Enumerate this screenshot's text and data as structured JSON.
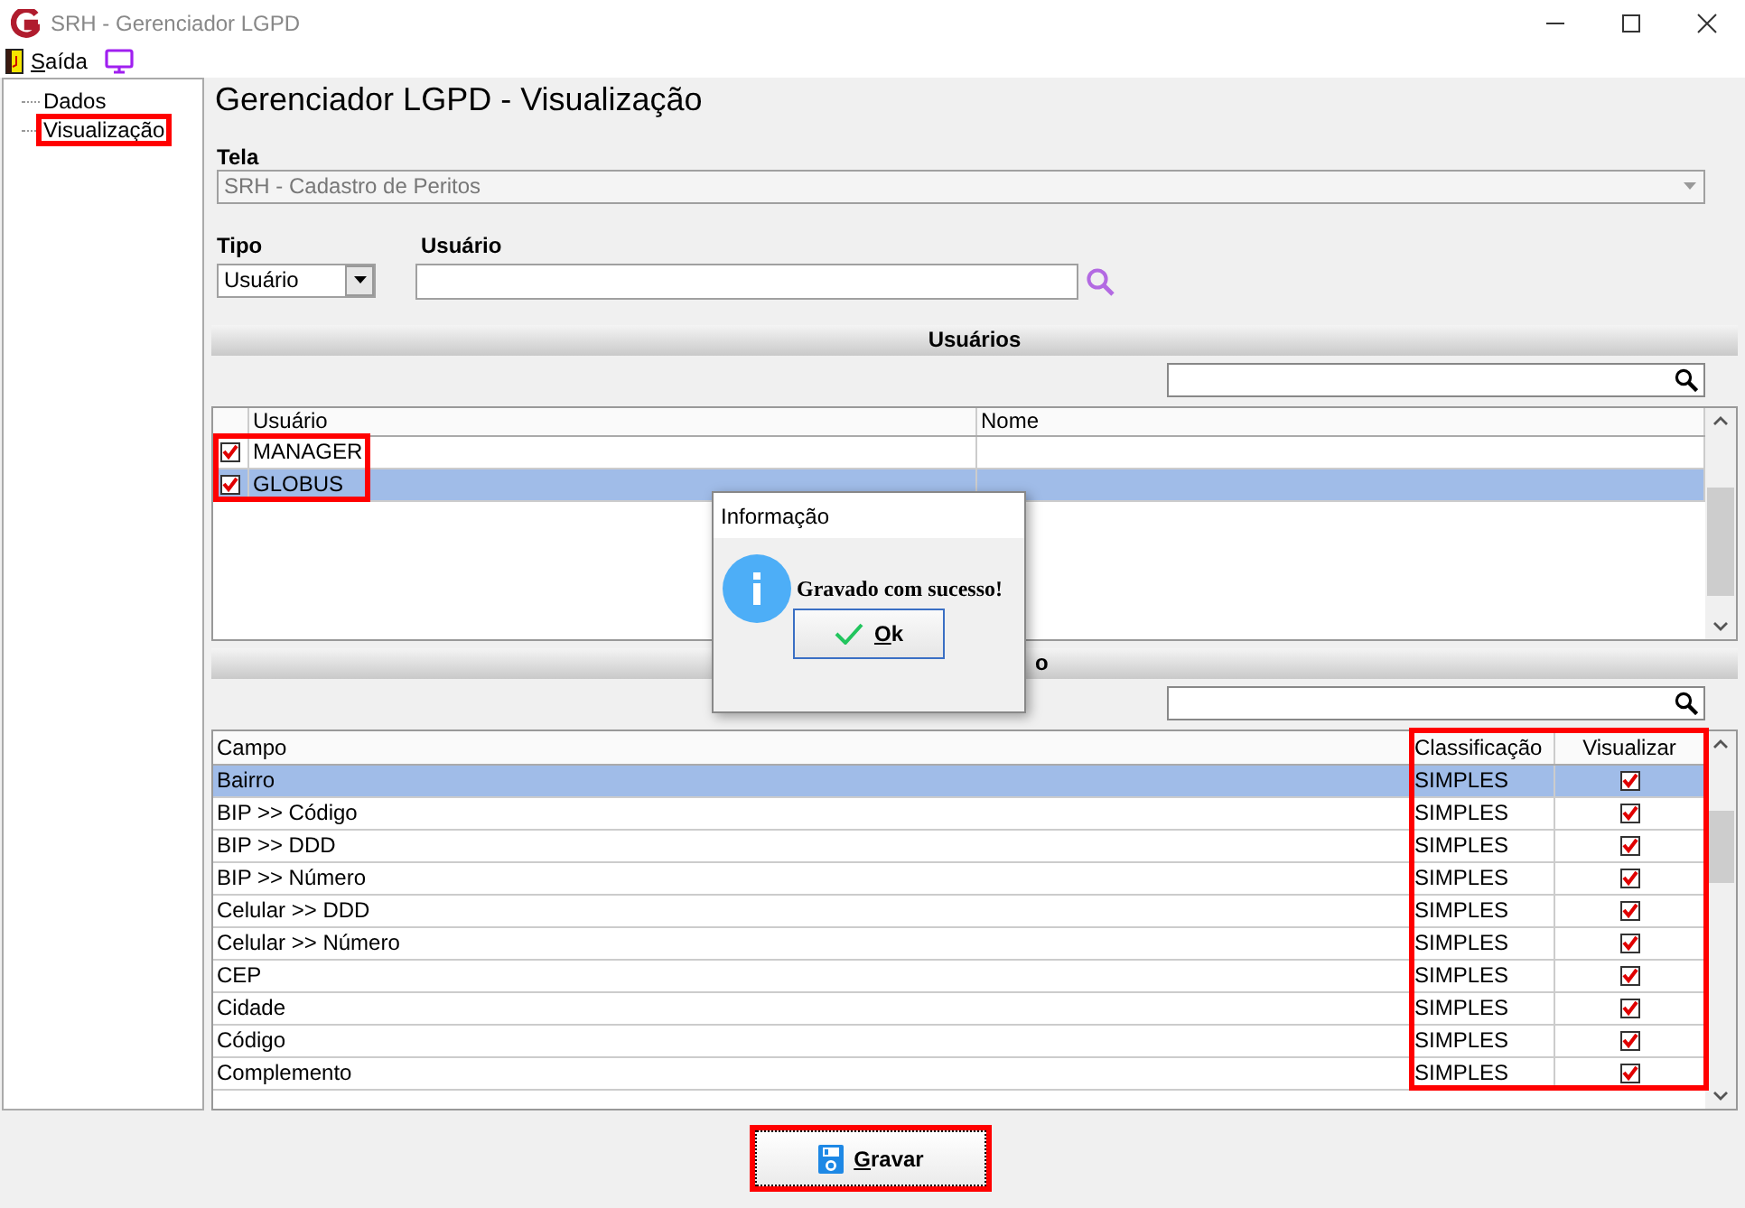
{
  "window": {
    "title": "SRH - Gerenciador LGPD"
  },
  "menu": [
    {
      "label": "Saída",
      "kind": "exit"
    },
    {
      "kind": "screen"
    }
  ],
  "sidebar": {
    "items": [
      {
        "label": "Dados",
        "selected": false,
        "highlighted": false
      },
      {
        "label": "Visualização",
        "selected": false,
        "highlighted": true
      }
    ]
  },
  "heading": "Gerenciador LGPD - Visualização",
  "tela": {
    "label": "Tela",
    "value": "SRH - Cadastro de Peritos"
  },
  "tipo": {
    "label": "Tipo",
    "value": "Usuário"
  },
  "usuario": {
    "label": "Usuário"
  },
  "users": {
    "title": "Usuários",
    "highlight_rows": true,
    "columns": [
      "Usuário",
      "Nome"
    ],
    "rows": [
      {
        "checked": true,
        "selected": false,
        "cells": [
          "MANAGER",
          ""
        ]
      },
      {
        "checked": true,
        "selected": true,
        "cells": [
          "GLOBUS",
          ""
        ]
      }
    ]
  },
  "fields": {
    "title_visible": "o",
    "highlight_columns": true,
    "columns": [
      "Campo",
      "Classificação",
      "Visualizar"
    ],
    "rows": [
      {
        "campo": "Bairro",
        "classificacao": "SIMPLES",
        "checked": true,
        "selected": true
      },
      {
        "campo": "BIP >> Código",
        "classificacao": "SIMPLES",
        "checked": true,
        "selected": false
      },
      {
        "campo": "BIP >> DDD",
        "classificacao": "SIMPLES",
        "checked": true,
        "selected": false
      },
      {
        "campo": "BIP >> Número",
        "classificacao": "SIMPLES",
        "checked": true,
        "selected": false
      },
      {
        "campo": "Celular >> DDD",
        "classificacao": "SIMPLES",
        "checked": true,
        "selected": false
      },
      {
        "campo": "Celular >> Número",
        "classificacao": "SIMPLES",
        "checked": true,
        "selected": false
      },
      {
        "campo": "CEP",
        "classificacao": "SIMPLES",
        "checked": true,
        "selected": false
      },
      {
        "campo": "Cidade",
        "classificacao": "SIMPLES",
        "checked": true,
        "selected": false
      },
      {
        "campo": "Código",
        "classificacao": "SIMPLES",
        "checked": true,
        "selected": false
      },
      {
        "campo": "Complemento",
        "classificacao": "SIMPLES",
        "checked": true,
        "selected": false
      }
    ]
  },
  "save_button": {
    "label": "Gravar",
    "highlighted": true
  },
  "dialog": {
    "title": "Informação",
    "message": "Gravado com sucesso!",
    "button": {
      "label": "Ok"
    }
  }
}
